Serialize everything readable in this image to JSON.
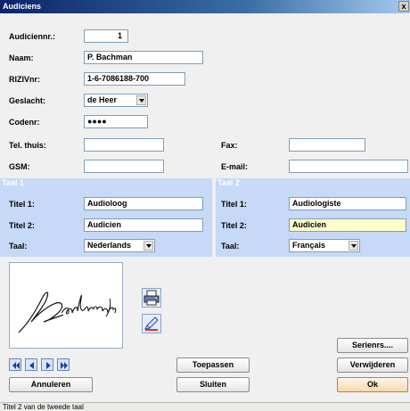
{
  "window": {
    "title": "Audiciens",
    "close_glyph": "x"
  },
  "form": {
    "audicien_nr": {
      "label": "Audiciennr.:",
      "value": "1"
    },
    "naam": {
      "label": "Naam:",
      "value": "P. Bachman"
    },
    "riziv": {
      "label": "RIZIVnr:",
      "value": "1-6-7086188-700"
    },
    "geslacht": {
      "label": "Geslacht:",
      "value": "de Heer"
    },
    "codenr": {
      "label": "Codenr:",
      "value": "●●●●"
    },
    "tel": {
      "label": "Tel. thuis:",
      "value": ""
    },
    "fax": {
      "label": "Fax:",
      "value": ""
    },
    "gsm": {
      "label": "GSM:",
      "value": ""
    },
    "email": {
      "label": "E-mail:",
      "value": ""
    }
  },
  "taal1": {
    "title": "Taal 1",
    "titel1": {
      "label": "Titel 1:",
      "value": "Audioloog"
    },
    "titel2": {
      "label": "Titel 2:",
      "value": "Audicien"
    },
    "taal": {
      "label": "Taal:",
      "value": "Nederlands"
    }
  },
  "taal2": {
    "title": "Taal 2",
    "titel1": {
      "label": "Titel 1:",
      "value": "Audiologiste"
    },
    "titel2": {
      "label": "Titel 2:",
      "value": "Audicien"
    },
    "taal": {
      "label": "Taal:",
      "value": "Français"
    }
  },
  "buttons": {
    "serienrs": "Serienrs....",
    "toepassen": "Toepassen",
    "verwijderen": "Verwijderen",
    "annuleren": "Annuleren",
    "sluiten": "Sluiten",
    "ok": "Ok"
  },
  "status": "Titel 2 van de tweede taal",
  "colors": {
    "panel": "#c6d9f7",
    "focus_field": "#ffffc8",
    "ok_button": "#f7d7ad"
  },
  "icons": [
    "printer-icon",
    "edit-signature-icon",
    "first-record-icon",
    "previous-record-icon",
    "next-record-icon",
    "last-record-icon"
  ]
}
